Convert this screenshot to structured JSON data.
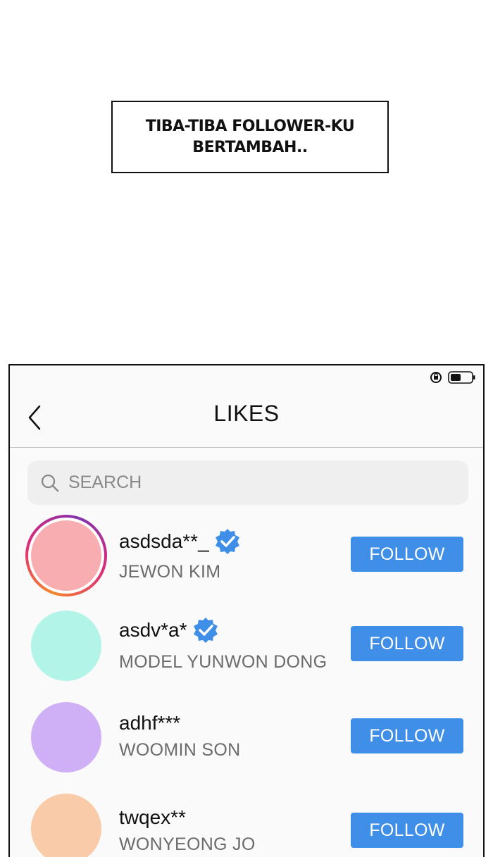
{
  "caption": {
    "text": "TIBA-TIBA FOLLOWER-KU BERTAMBAH.."
  },
  "status_bar": {
    "icons": [
      "rotation-lock-icon",
      "battery-icon"
    ]
  },
  "header": {
    "title": "LIKES",
    "back_icon": "chevron-left-icon"
  },
  "search": {
    "placeholder": "SEARCH",
    "icon": "search-icon"
  },
  "users": [
    {
      "username": "asdsda**_",
      "name": "JEWON KIM",
      "verified": true,
      "story_ring": true,
      "avatar_color": "#f8aeb0",
      "follow_label": "FOLLOW"
    },
    {
      "username": "asdv*a*",
      "name": "MODEL YUNWON DONG",
      "verified": true,
      "story_ring": false,
      "avatar_color": "#b2f5e8",
      "follow_label": "FOLLOW"
    },
    {
      "username": "adhf***",
      "name": "WOOMIN SON",
      "verified": false,
      "story_ring": false,
      "avatar_color": "#cfb0f7",
      "follow_label": "FOLLOW"
    },
    {
      "username": "twqex**",
      "name": "WONYEONG JO",
      "verified": false,
      "story_ring": false,
      "avatar_color": "#f9cba8",
      "follow_label": "FOLLOW"
    }
  ],
  "colors": {
    "follow_button": "#3f8ee8",
    "verified_badge": "#3f8ee8",
    "secondary_text": "#6b6b6b"
  }
}
